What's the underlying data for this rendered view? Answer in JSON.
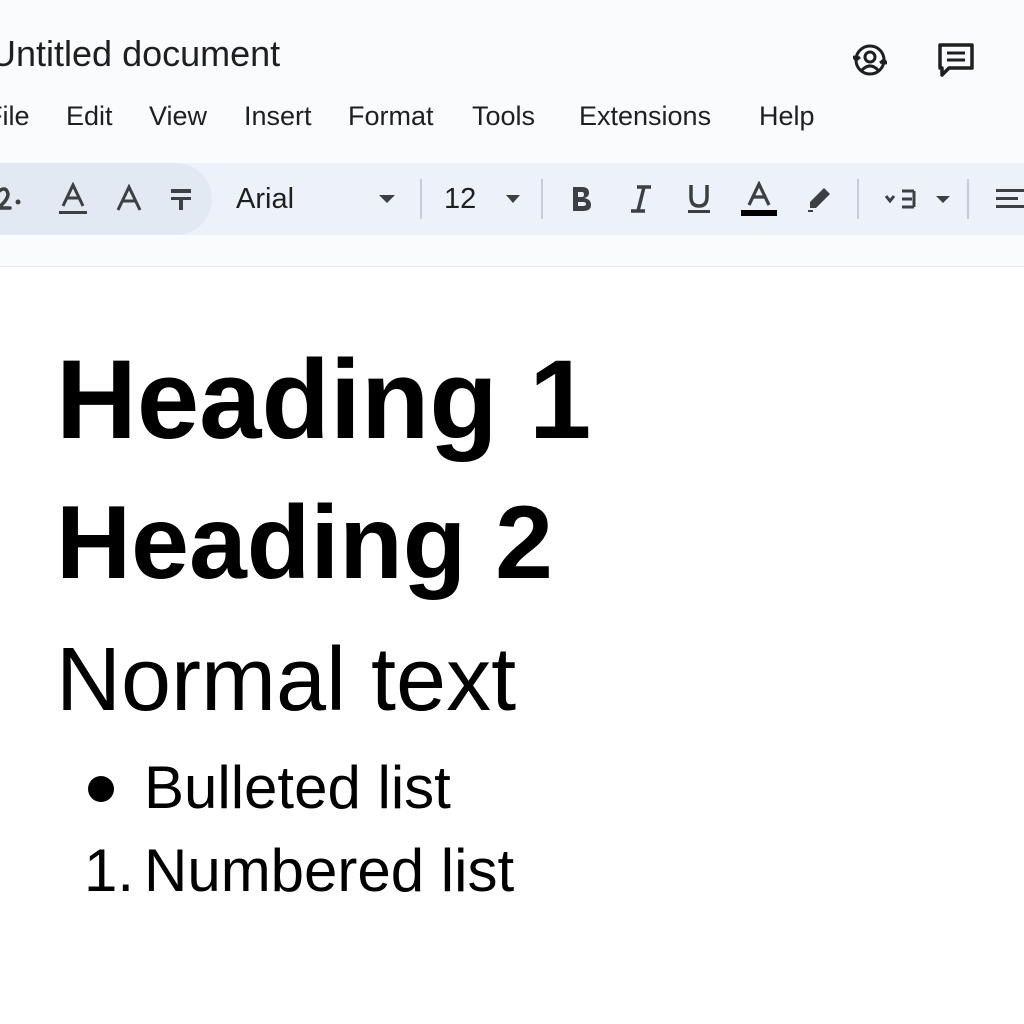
{
  "header": {
    "doc_title": "Untitled document",
    "icons": [
      "collaborate-icon",
      "comment-icon"
    ]
  },
  "menu": {
    "items": [
      "File",
      "Edit",
      "View",
      "Insert",
      "Format",
      "Tools",
      "Extensions",
      "Help"
    ]
  },
  "toolbar": {
    "font_name": "Arial",
    "font_size": "12",
    "icons": [
      "spellcheck-icon",
      "text-style-icon",
      "text-size-icon",
      "clear-format-icon",
      "font-dropdown-icon",
      "size-dropdown-icon",
      "bold-icon",
      "italic-icon",
      "underline-icon",
      "text-color-icon",
      "highlight-icon",
      "line-spacing-icon",
      "align-left-icon"
    ]
  },
  "document": {
    "heading1": "Heading 1",
    "heading2": "Heading 2",
    "normal_text": "Normal text",
    "bulleted_item": "Bulleted list",
    "numbered_marker": "1.",
    "numbered_item": "Numbered list"
  },
  "colors": {
    "header_bg": "#f9fbfd",
    "toolbar_bg": "#edf2fa",
    "text": "#1f1f1f"
  }
}
